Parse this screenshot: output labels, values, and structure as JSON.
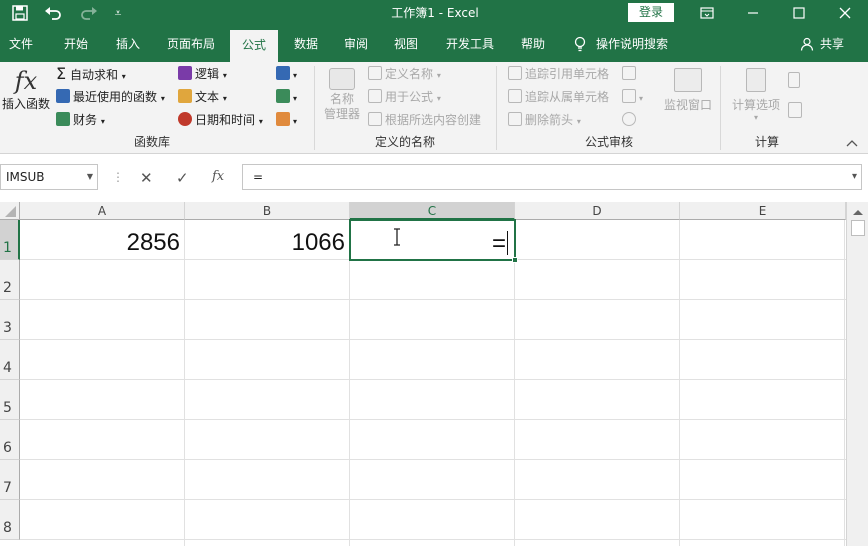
{
  "titlebar": {
    "doc_title": "工作簿1 - Excel",
    "login_label": "登录",
    "save_icon": "save-icon",
    "undo_icon": "undo-icon",
    "redo_icon": "redo-icon"
  },
  "tabs": [
    "文件",
    "开始",
    "插入",
    "页面布局",
    "公式",
    "数据",
    "审阅",
    "视图",
    "开发工具",
    "帮助"
  ],
  "active_tab": "公式",
  "tell_me": "操作说明搜索",
  "share_label": "共享",
  "ribbon": {
    "func_lib": {
      "label": "函数库",
      "insert_function": "插入函数",
      "fx_glyph": "fx",
      "autosum": "自动求和",
      "recent": "最近使用的函数",
      "financial": "财务",
      "logical": "逻辑",
      "text": "文本",
      "datetime": "日期和时间"
    },
    "defined_names": {
      "label": "定义的名称",
      "name_manager": "名称\n管理器",
      "define_name": "定义名称",
      "use_in_formula": "用于公式",
      "create_from_selection": "根据所选内容创建"
    },
    "formula_auditing": {
      "label": "公式审核",
      "trace_precedents": "追踪引用单元格",
      "trace_dependents": "追踪从属单元格",
      "remove_arrows": "删除箭头",
      "watch_window": "监视窗口"
    },
    "calculation": {
      "label": "计算",
      "calc_options": "计算选项"
    }
  },
  "formula_bar": {
    "name_box": "IMSUB",
    "formula": "=",
    "cancel_glyph": "✕",
    "enter_glyph": "✓",
    "fx_glyph": "fx"
  },
  "columns": [
    "A",
    "B",
    "C",
    "D",
    "E"
  ],
  "selected_column": "C",
  "rows": [
    "1",
    "2",
    "3",
    "4",
    "5",
    "6",
    "7",
    "8"
  ],
  "cells": {
    "A1": "2856",
    "B1": "1066",
    "C1": "="
  },
  "colors": {
    "brand": "#217346"
  }
}
